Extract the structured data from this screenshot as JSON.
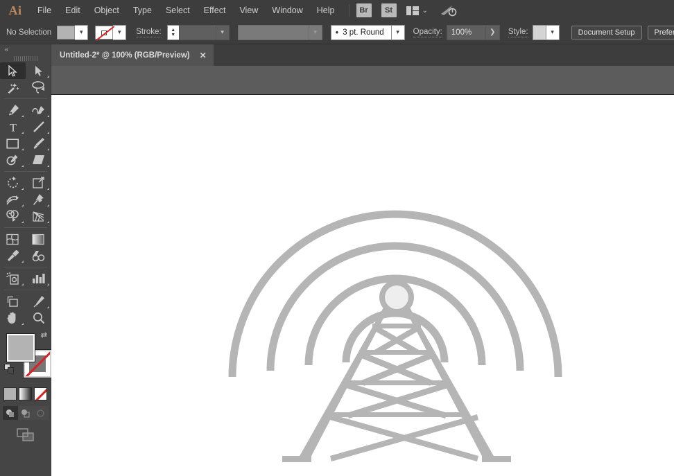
{
  "app": {
    "logo": "Ai",
    "title": "Adobe Illustrator"
  },
  "menubar": {
    "items": [
      {
        "label": "File"
      },
      {
        "label": "Edit"
      },
      {
        "label": "Object"
      },
      {
        "label": "Type"
      },
      {
        "label": "Select"
      },
      {
        "label": "Effect"
      },
      {
        "label": "View"
      },
      {
        "label": "Window"
      },
      {
        "label": "Help"
      }
    ],
    "bridge_button": "Br",
    "stock_button": "St",
    "arrange_chevron": "⌄",
    "rocket_icon": "rocket-icon"
  },
  "controlbar": {
    "selection_status": "No Selection",
    "fill_label": "fill-swatch",
    "fill_color": "#b3b3b3",
    "stroke_swatch_label": "stroke-none-swatch",
    "stroke_label": "Stroke:",
    "stroke_weight_value": "",
    "width_profile_value": "",
    "brush_definition_value": "3 pt. Round",
    "opacity_label": "Opacity:",
    "opacity_value": "100%",
    "style_label": "Style:",
    "document_setup_button": "Document Setup",
    "preferences_button": "Preferences",
    "arrange_icon": "align-objects-icon",
    "chevron": "⌄"
  },
  "tabs": [
    {
      "title": "Untitled-2* @ 100% (RGB/Preview)",
      "close": "✕",
      "active": true
    }
  ],
  "toolbar": {
    "collapse_icon": "«",
    "tools": [
      {
        "name": "selection-tool",
        "active": true,
        "has_flyout": false
      },
      {
        "name": "direct-selection-tool",
        "active": false,
        "has_flyout": true
      },
      {
        "name": "magic-wand-tool",
        "active": false,
        "has_flyout": false
      },
      {
        "name": "lasso-tool",
        "active": false,
        "has_flyout": false
      },
      {
        "name": "pen-tool",
        "active": false,
        "has_flyout": true
      },
      {
        "name": "curvature-tool",
        "active": false,
        "has_flyout": true
      },
      {
        "name": "type-tool",
        "active": false,
        "has_flyout": true
      },
      {
        "name": "line-segment-tool",
        "active": false,
        "has_flyout": true
      },
      {
        "name": "rectangle-tool",
        "active": false,
        "has_flyout": true
      },
      {
        "name": "paintbrush-tool",
        "active": false,
        "has_flyout": true
      },
      {
        "name": "shaper-tool",
        "active": false,
        "has_flyout": true
      },
      {
        "name": "eraser-tool",
        "active": false,
        "has_flyout": true
      },
      {
        "name": "rotate-tool",
        "active": false,
        "has_flyout": true
      },
      {
        "name": "scale-tool",
        "active": false,
        "has_flyout": true
      },
      {
        "name": "width-tool",
        "active": false,
        "has_flyout": true
      },
      {
        "name": "free-transform-tool",
        "active": false,
        "has_flyout": true
      },
      {
        "name": "shape-builder-tool",
        "active": false,
        "has_flyout": true
      },
      {
        "name": "perspective-grid-tool",
        "active": false,
        "has_flyout": true
      },
      {
        "name": "mesh-tool",
        "active": false,
        "has_flyout": false
      },
      {
        "name": "gradient-tool",
        "active": false,
        "has_flyout": false
      },
      {
        "name": "eyedropper-tool",
        "active": false,
        "has_flyout": true
      },
      {
        "name": "blend-tool",
        "active": false,
        "has_flyout": false
      },
      {
        "name": "symbol-sprayer-tool",
        "active": false,
        "has_flyout": true
      },
      {
        "name": "column-graph-tool",
        "active": false,
        "has_flyout": true
      },
      {
        "name": "artboard-tool",
        "active": false,
        "has_flyout": false
      },
      {
        "name": "slice-tool",
        "active": false,
        "has_flyout": true
      },
      {
        "name": "hand-tool",
        "active": false,
        "has_flyout": true
      },
      {
        "name": "zoom-tool",
        "active": false,
        "has_flyout": false
      }
    ],
    "fill_color": "#b3b3b3",
    "stroke_color": "none",
    "swap_icon": "swap-fill-stroke-icon",
    "default_icon": "default-fill-stroke-icon",
    "color_mode_buttons": [
      {
        "name": "color-button",
        "active": true
      },
      {
        "name": "gradient-button",
        "active": false
      },
      {
        "name": "none-button",
        "active": false
      }
    ],
    "drawing_modes": [
      {
        "name": "draw-normal-button",
        "active": true
      },
      {
        "name": "draw-behind-button",
        "active": false
      },
      {
        "name": "draw-inside-button",
        "active": false
      }
    ],
    "screen_mode_button": "change-screen-mode-icon"
  },
  "canvas": {
    "background_color": "#5c5c5c",
    "artboard_color": "#ffffff",
    "artwork_name": "radio-broadcast-tower-illustration",
    "artwork_color": "#b5b5b5",
    "artwork_accent_color": "#eeeeee",
    "zoom_level": "100%",
    "color_mode": "RGB",
    "view_mode": "Preview"
  }
}
